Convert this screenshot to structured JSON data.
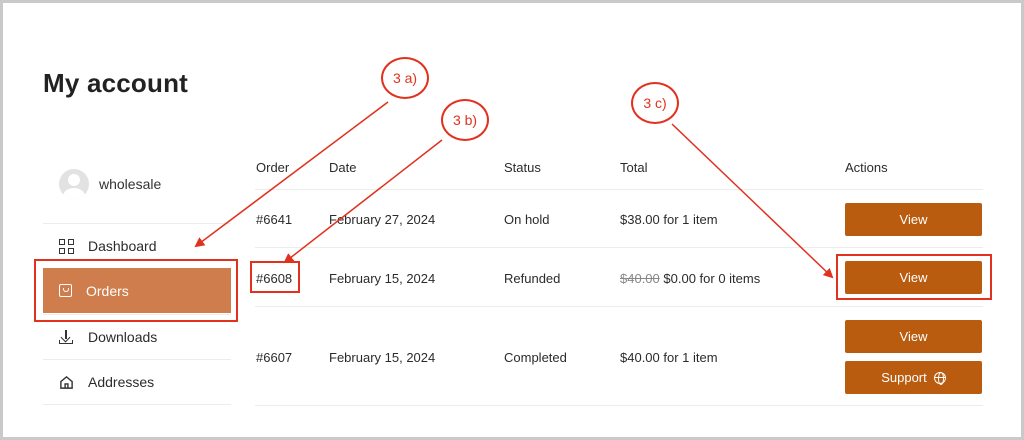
{
  "page": {
    "title": "My account"
  },
  "user": {
    "name": "wholesale"
  },
  "nav": {
    "items": [
      {
        "label": "Dashboard",
        "icon": "dashboard-icon"
      },
      {
        "label": "Orders",
        "icon": "shopping-bag-icon",
        "active": true
      },
      {
        "label": "Downloads",
        "icon": "download-icon"
      },
      {
        "label": "Addresses",
        "icon": "home-icon"
      }
    ]
  },
  "orders": {
    "columns": [
      "Order",
      "Date",
      "Status",
      "Total",
      "Actions"
    ],
    "rows": [
      {
        "order": "#6641",
        "date": "February 27, 2024",
        "status": "On hold",
        "total": "$38.00 for 1 item",
        "actions": [
          "View"
        ]
      },
      {
        "order": "#6608",
        "date": "February 15, 2024",
        "status": "Refunded",
        "total_old": "$40.00",
        "total": "$0.00 for 0 items",
        "actions": [
          "View"
        ]
      },
      {
        "order": "#6607",
        "date": "February 15, 2024",
        "status": "Completed",
        "total": "$40.00 for 1 item",
        "actions": [
          "View",
          "Support"
        ]
      }
    ]
  },
  "annotations": {
    "a": "3 a)",
    "b": "3 b)",
    "c": "3 c)",
    "color": "#e0321f"
  },
  "colors": {
    "accent": "#b95c0f",
    "active_nav": "#cf7d4c"
  }
}
